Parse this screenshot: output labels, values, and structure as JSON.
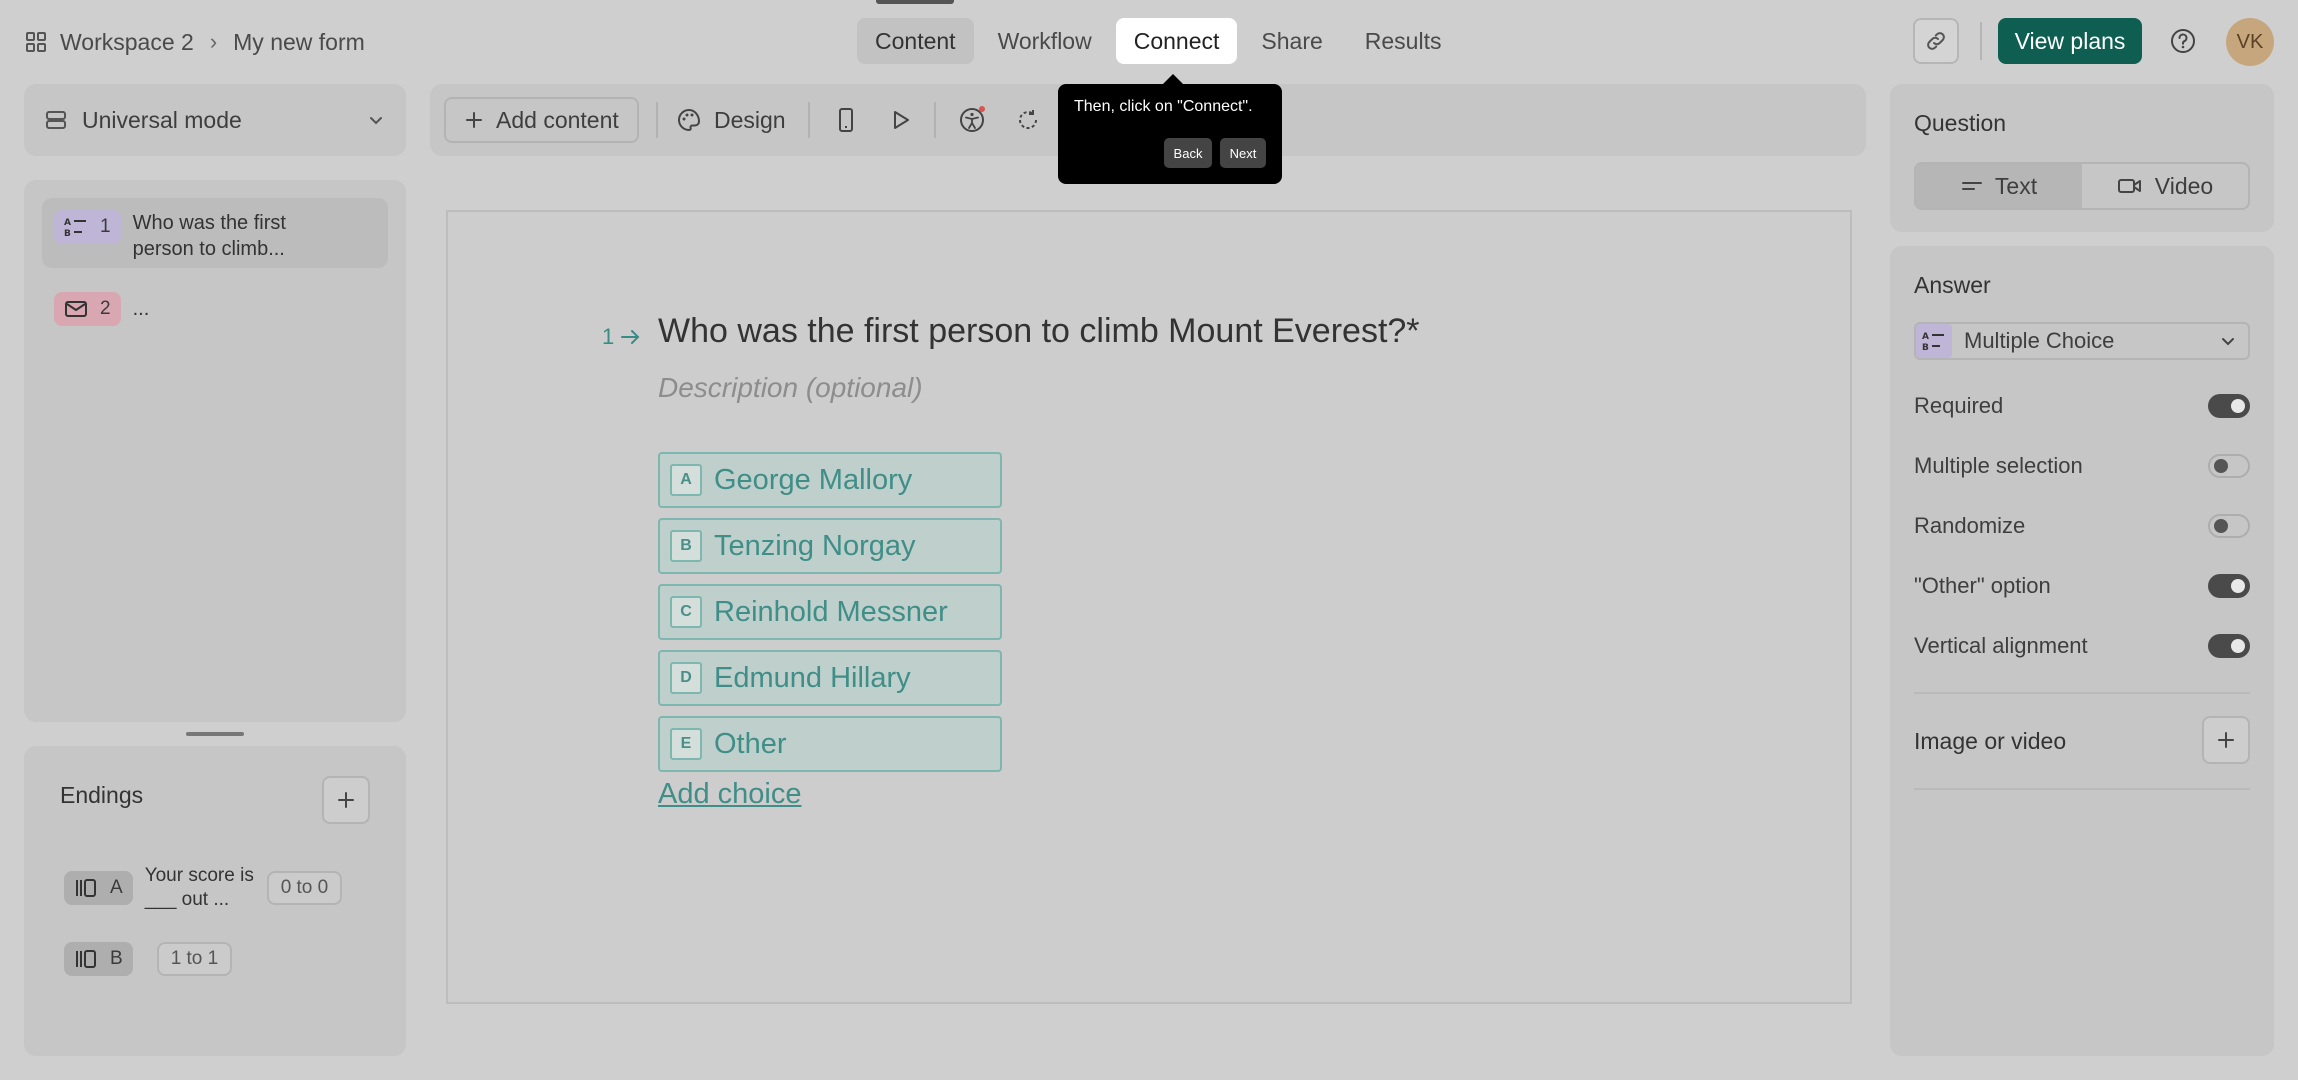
{
  "header": {
    "workspace": "Workspace 2",
    "form_name": "My new form",
    "tabs": [
      {
        "label": "Content"
      },
      {
        "label": "Workflow"
      },
      {
        "label": "Connect"
      },
      {
        "label": "Share"
      },
      {
        "label": "Results"
      }
    ],
    "plans_label": "View plans",
    "avatar_initials": "VK"
  },
  "left": {
    "mode_label": "Universal mode",
    "questions": [
      {
        "num": "1",
        "text": "Who was the first person to climb..."
      },
      {
        "num": "2",
        "text": "..."
      }
    ],
    "endings_title": "Endings",
    "endings": [
      {
        "key": "A",
        "text": "Your score is ___ out ...",
        "range": "0 to 0"
      },
      {
        "key": "B",
        "text": "",
        "range": "1 to 1"
      }
    ]
  },
  "toolbar": {
    "add_content": "Add content",
    "design": "Design"
  },
  "tooltip": {
    "message": "Then, click on \"Connect\".",
    "back": "Back",
    "next": "Next"
  },
  "question": {
    "number": "1",
    "title": "Who was the first person to climb Mount Everest?*",
    "description_placeholder": "Description (optional)",
    "choices": [
      {
        "key": "A",
        "label": "George Mallory"
      },
      {
        "key": "B",
        "label": "Tenzing Norgay"
      },
      {
        "key": "C",
        "label": "Reinhold Messner"
      },
      {
        "key": "D",
        "label": "Edmund Hillary"
      },
      {
        "key": "E",
        "label": "Other"
      }
    ],
    "add_choice": "Add choice"
  },
  "right": {
    "question_title": "Question",
    "question_types": [
      {
        "label": "Text"
      },
      {
        "label": "Video"
      }
    ],
    "answer_title": "Answer",
    "answer_type": "Multiple Choice",
    "settings": [
      {
        "label": "Required",
        "on": true
      },
      {
        "label": "Multiple selection",
        "on": false
      },
      {
        "label": "Randomize",
        "on": false
      },
      {
        "label": "\"Other\" option",
        "on": true
      },
      {
        "label": "Vertical alignment",
        "on": true
      }
    ],
    "media_title": "Image or video"
  },
  "colors": {
    "accent": "#0e5e52",
    "choice_text": "#3f8e88",
    "background": "#cfcfcf"
  }
}
